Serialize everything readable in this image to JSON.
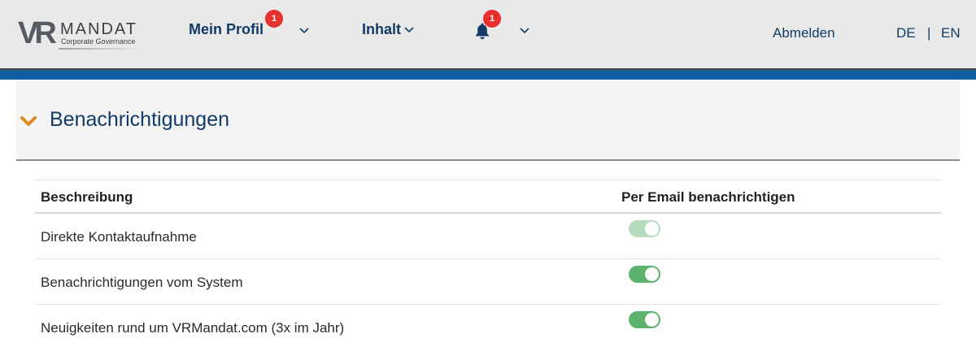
{
  "logo": {
    "mark": "VR",
    "name": "MANDAT",
    "tagline": "Corporate Governance"
  },
  "nav": {
    "profile_label": "Mein Profil",
    "profile_badge": "1",
    "content_label": "Inhalt",
    "bell_badge": "1",
    "logout_label": "Abmelden",
    "lang_de": "DE",
    "lang_separator": "|",
    "lang_en": "EN"
  },
  "section": {
    "title": "Benachrichtigungen"
  },
  "table": {
    "columns": [
      "Beschreibung",
      "Per Email benachrichtigen"
    ],
    "rows": [
      {
        "label": "Direkte Kontaktaufnahme",
        "email_enabled": true,
        "disabled": true
      },
      {
        "label": "Benachrichtigungen vom System",
        "email_enabled": true,
        "disabled": false
      },
      {
        "label": "Neuigkeiten rund um VRMandat.com (3x im Jahr)",
        "email_enabled": true,
        "disabled": false
      }
    ]
  },
  "colors": {
    "nav_text": "#123a66",
    "badge": "#e8302f",
    "accent_stripe": "#0f5fa3",
    "section_chevron": "#e08a1e",
    "toggle_on": "#5cb36c",
    "toggle_disabled": "#b5dcbd"
  },
  "icons": {
    "bell": "bell-icon",
    "dropdown": "chevron-down-icon",
    "section_toggle": "chevron-down-icon"
  }
}
